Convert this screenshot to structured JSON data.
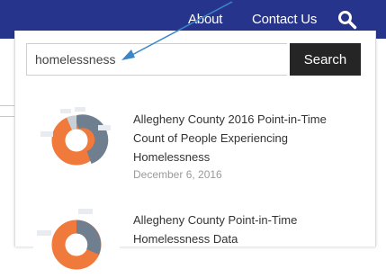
{
  "nav": {
    "about_label": "About",
    "contact_label": "Contact Us"
  },
  "search": {
    "value": "homelessness",
    "placeholder": "",
    "button_label": "Search"
  },
  "results": [
    {
      "title": "Allegheny County 2016 Point-in-Time Count of People Experiencing Homelessness",
      "date": "December 6, 2016"
    },
    {
      "title": "Allegheny County Point-in-Time Homelessness Data"
    }
  ],
  "colors": {
    "nav_bg": "#27348b",
    "button_bg": "#252525",
    "arrow": "#3b86c8",
    "donut_gray": "#6f7f8f",
    "donut_orange": "#f07a3c",
    "donut_light": "#c9d1d8"
  }
}
